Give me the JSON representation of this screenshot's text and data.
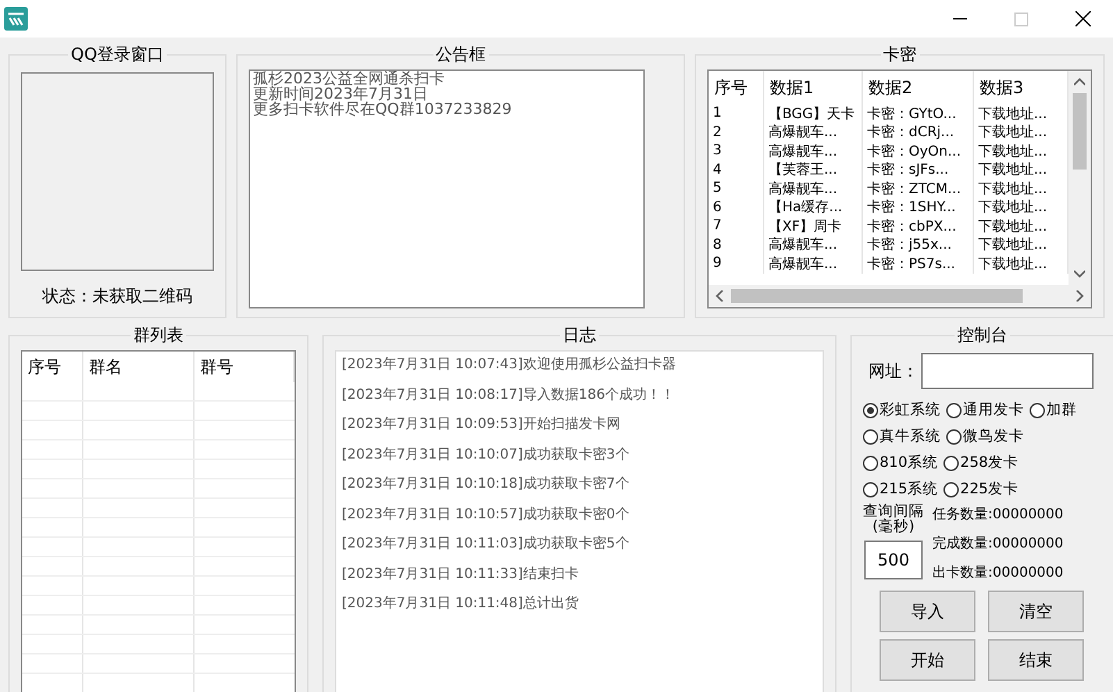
{
  "qq_login": {
    "title": "QQ登录窗口",
    "status": "状态：未获取二维码"
  },
  "notice": {
    "title": "公告框",
    "lines": [
      "孤杉2023公益全网通杀扫卡",
      "更新时间2023年7月31日",
      "更多扫卡软件尽在QQ群1037233829"
    ]
  },
  "cards": {
    "title": "卡密",
    "columns": [
      "序号",
      "数据1",
      "数据2",
      "数据3"
    ],
    "rows": [
      [
        "1",
        "【BGG】天卡",
        "卡密：GYtO...",
        "下载地址..."
      ],
      [
        "2",
        "高爆靓车...",
        "卡密：dCRj...",
        "下载地址..."
      ],
      [
        "3",
        "高爆靓车...",
        "卡密：OyOn...",
        "下载地址..."
      ],
      [
        "4",
        "【芙蓉王...",
        "卡密：sJFs...",
        "下载地址..."
      ],
      [
        "5",
        "高爆靓车...",
        "卡密：ZTCM...",
        "下载地址..."
      ],
      [
        "6",
        "【Ha缓存...",
        "卡密：1SHY...",
        "下载地址..."
      ],
      [
        "7",
        "【XF】周卡",
        "卡密：cbPX...",
        "下载地址..."
      ],
      [
        "8",
        "高爆靓车...",
        "卡密：j55x...",
        "下载地址..."
      ],
      [
        "9",
        "高爆靓车...",
        "卡密：PS7s...",
        "下载地址..."
      ]
    ]
  },
  "groups": {
    "title": "群列表",
    "columns": [
      "序号",
      "群名",
      "群号"
    ]
  },
  "log": {
    "title": "日志",
    "lines": [
      "[2023年7月31日 10:07:43]欢迎使用孤杉公益扫卡器",
      "[2023年7月31日 10:08:17]导入数据186个成功！！",
      "[2023年7月31日 10:09:53]开始扫描发卡网",
      "[2023年7月31日 10:10:07]成功获取卡密3个",
      "[2023年7月31日 10:10:18]成功获取卡密7个",
      "[2023年7月31日 10:10:57]成功获取卡密0个",
      "[2023年7月31日 10:11:03]成功获取卡密5个",
      "[2023年7月31日 10:11:33]结束扫卡",
      "[2023年7月31日 10:11:48]总计出货"
    ]
  },
  "console": {
    "title": "控制台",
    "url_label": "网址：",
    "systems": [
      [
        {
          "label": "彩虹系统",
          "selected": true
        },
        {
          "label": "通用发卡",
          "selected": false
        },
        {
          "label": "加群",
          "selected": false
        }
      ],
      [
        {
          "label": "真牛系统",
          "selected": false
        },
        {
          "label": "微鸟发卡",
          "selected": false
        }
      ],
      [
        {
          "label": "810系统",
          "selected": false
        },
        {
          "label": "258发卡",
          "selected": false
        }
      ],
      [
        {
          "label": "215系统",
          "selected": false
        },
        {
          "label": "225发卡",
          "selected": false
        }
      ]
    ],
    "interval_label": "查询间隔\n(毫秒)",
    "interval_value": "500",
    "stats": [
      {
        "label": "任务数量:",
        "value": "00000000"
      },
      {
        "label": "完成数量:",
        "value": "00000000"
      },
      {
        "label": "出卡数量:",
        "value": "00000000"
      }
    ],
    "buttons": [
      "导入",
      "清空",
      "开始",
      "结束"
    ]
  }
}
